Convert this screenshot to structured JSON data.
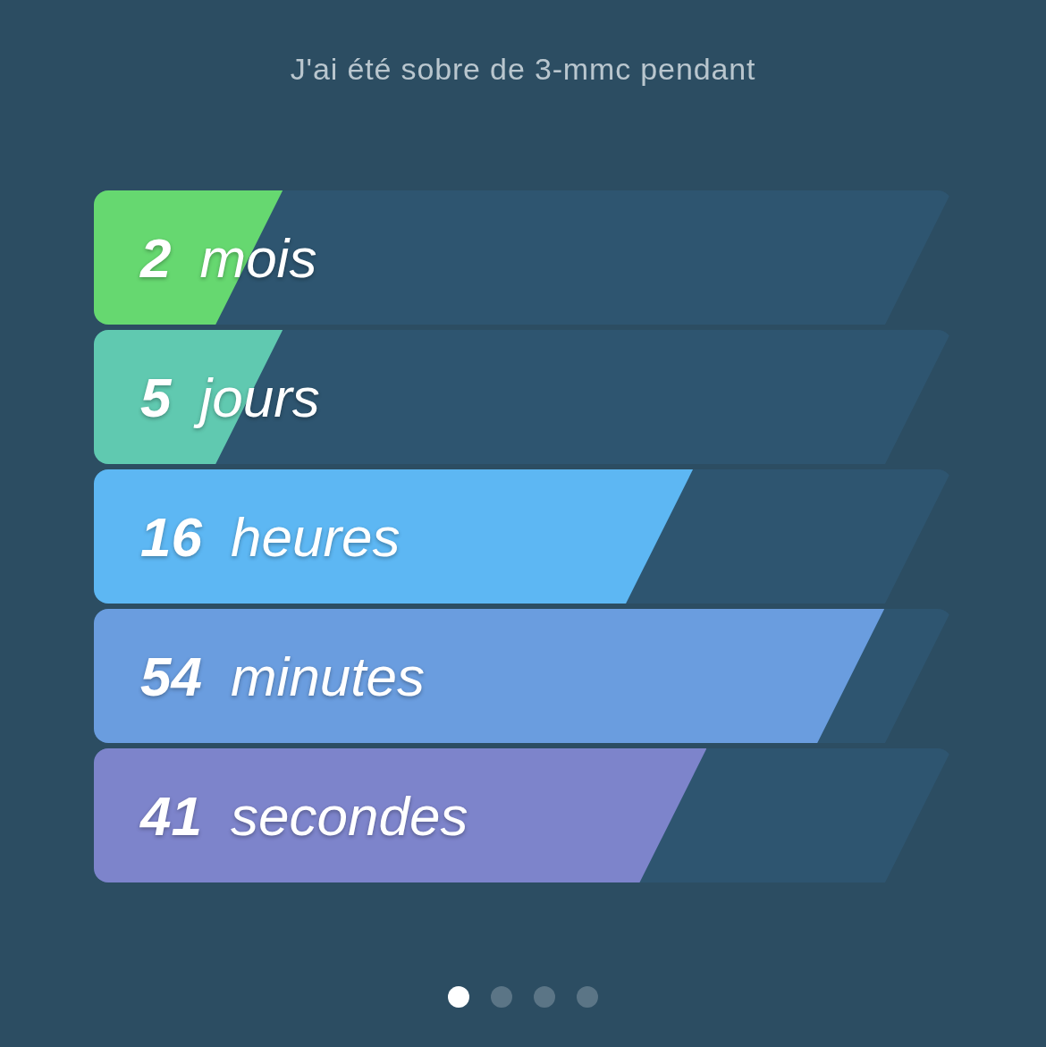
{
  "title": "J'ai été sobre de 3-mmc pendant",
  "rows": [
    {
      "value": "2",
      "unit": "mois",
      "level": 0.22,
      "color": "#66d870"
    },
    {
      "value": "5",
      "unit": "jours",
      "level": 0.22,
      "color": "#60c9b0"
    },
    {
      "value": "16",
      "unit": "heures",
      "level": 0.698,
      "color": "#5db7f3"
    },
    {
      "value": "54",
      "unit": "minutes",
      "level": 0.921,
      "color": "#6a9ddf"
    },
    {
      "value": "41",
      "unit": "secondes",
      "level": 0.714,
      "color": "#7d84cb"
    }
  ],
  "pages": [
    {
      "selected": true
    },
    {
      "selected": false
    },
    {
      "selected": false
    },
    {
      "selected": false
    }
  ]
}
